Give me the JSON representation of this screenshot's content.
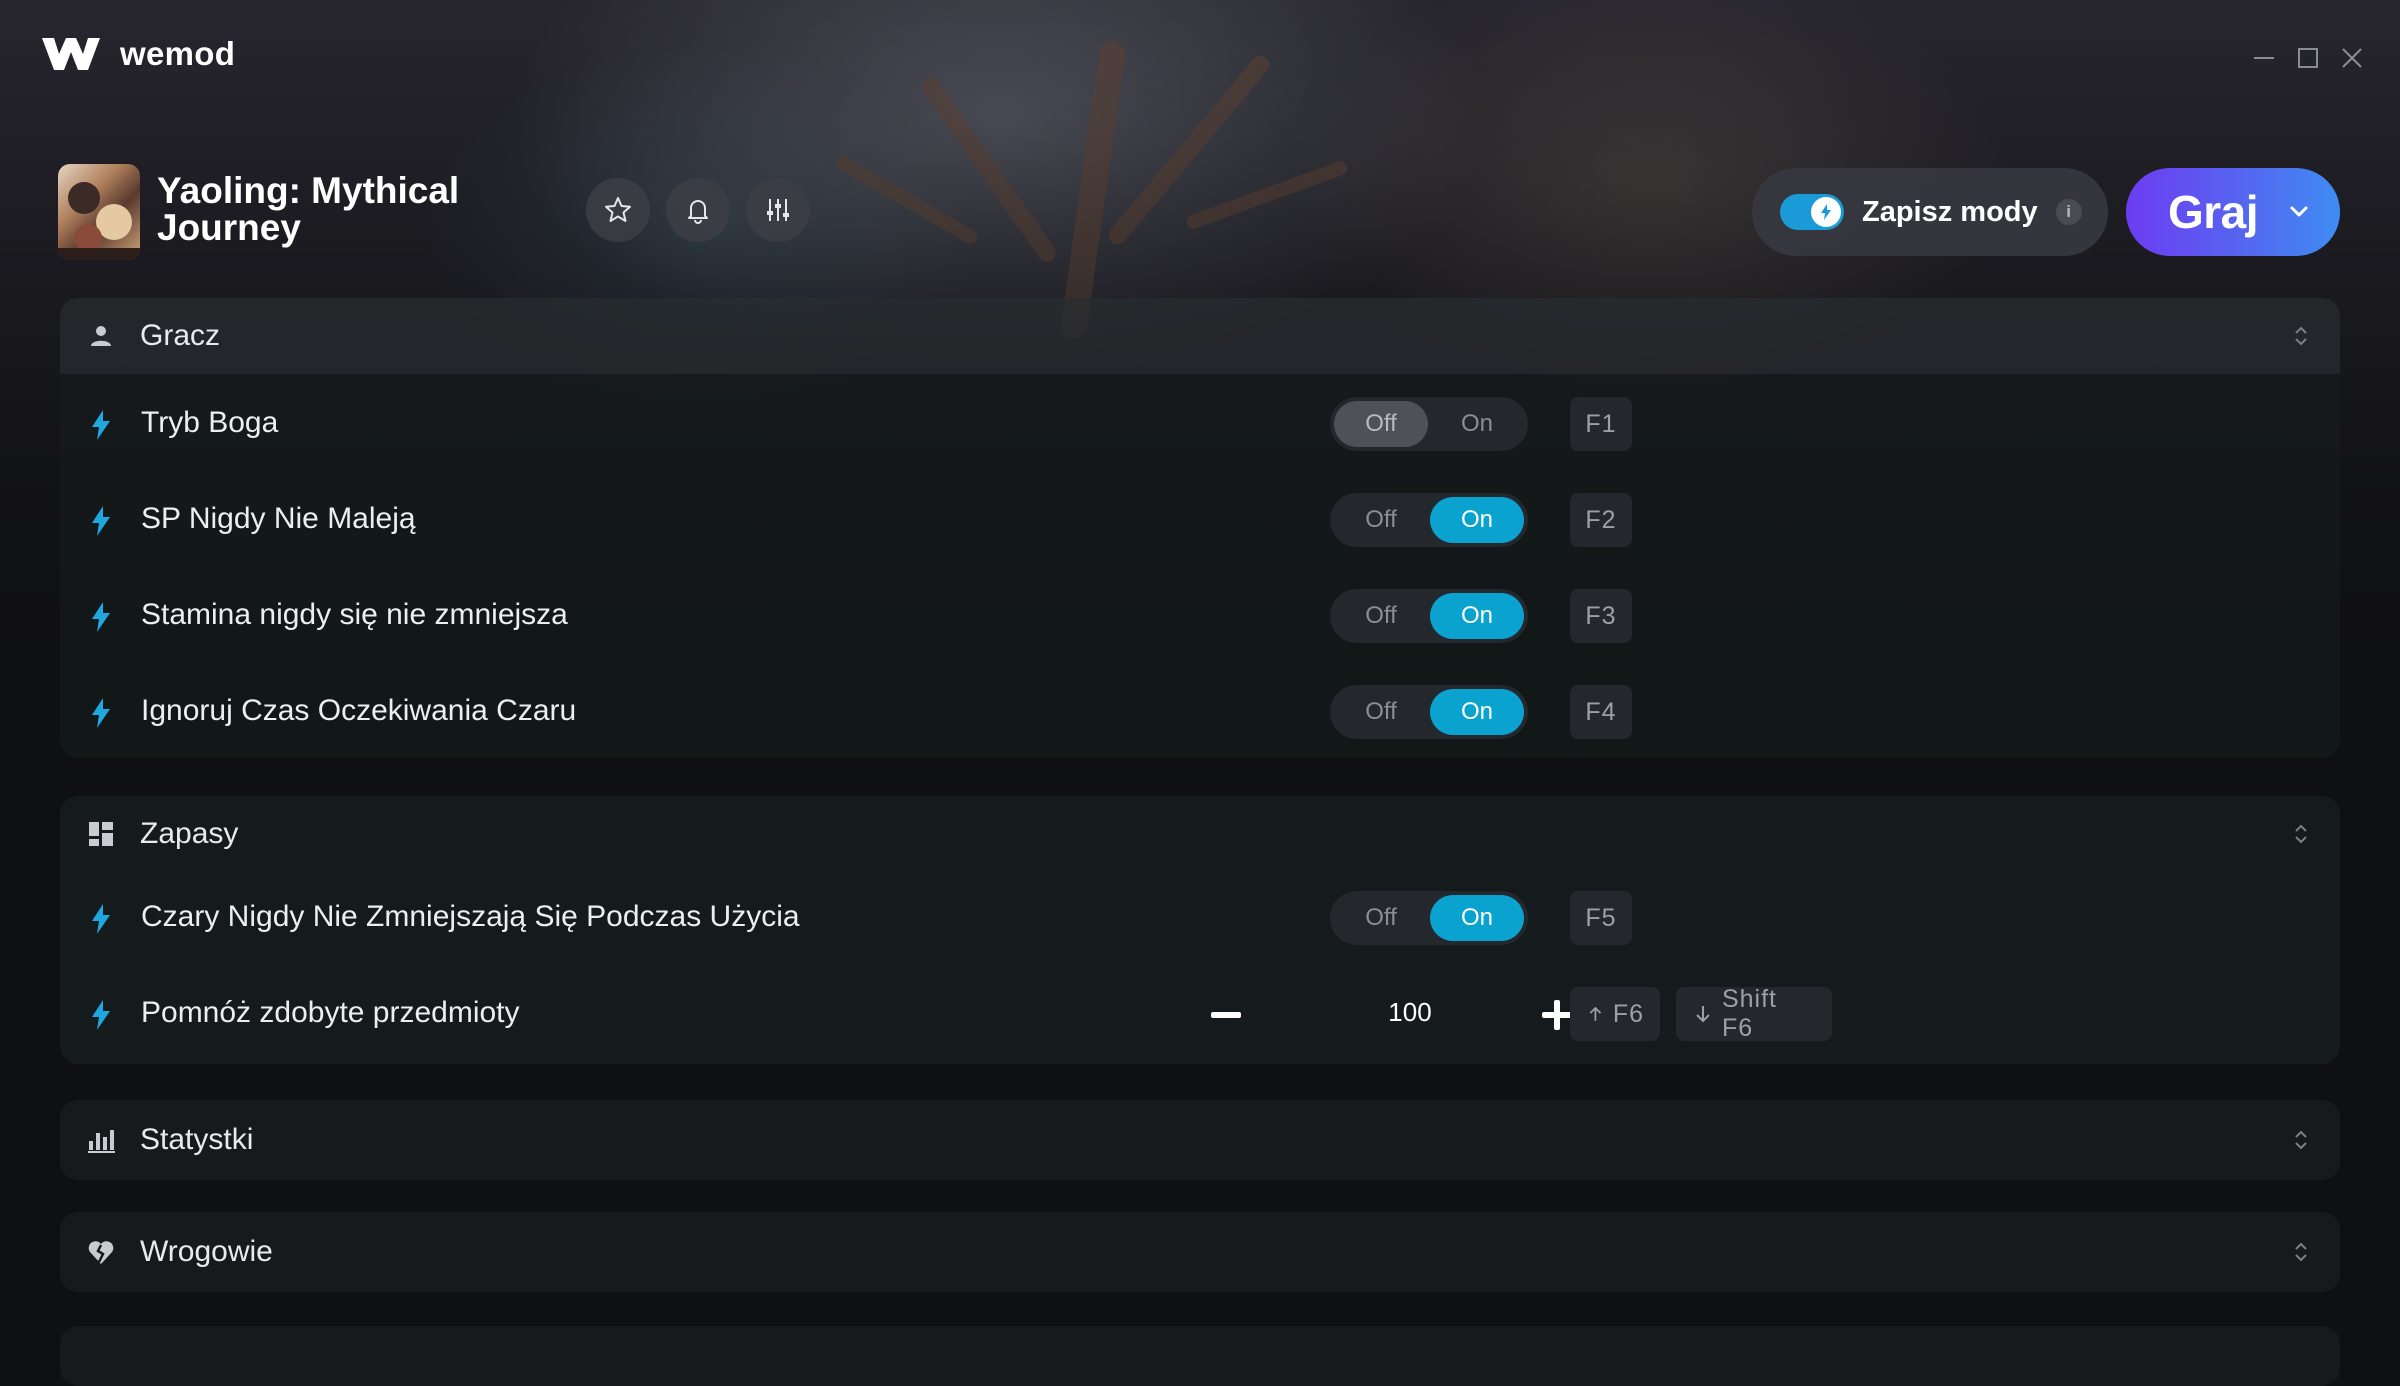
{
  "app": {
    "brand": "wemod"
  },
  "window": {
    "minimize": "minimize",
    "maximize": "maximize",
    "close": "close"
  },
  "game": {
    "title": "Yaoling: Mythical Journey"
  },
  "header": {
    "favorite_icon": "star-icon",
    "notify_icon": "bell-icon",
    "settings_icon": "sliders-icon",
    "save_mods_label": "Zapisz mody",
    "save_mods_enabled": true,
    "info_label": "i",
    "play_label": "Graj"
  },
  "sections": [
    {
      "title": "Gracz",
      "icon": "person-icon",
      "rows": [
        {
          "label": "Tryb Boga",
          "off": "Off",
          "on": "On",
          "state": "off",
          "hotkey": "F1"
        },
        {
          "label": "SP Nigdy Nie Maleją",
          "off": "Off",
          "on": "On",
          "state": "on",
          "hotkey": "F2"
        },
        {
          "label": "Stamina nigdy się nie zmniejsza",
          "off": "Off",
          "on": "On",
          "state": "on",
          "hotkey": "F3"
        },
        {
          "label": "Ignoruj Czas Oczekiwania Czaru",
          "off": "Off",
          "on": "On",
          "state": "on",
          "hotkey": "F4"
        }
      ]
    },
    {
      "title": "Zapasy",
      "icon": "dashboard-icon",
      "rows": [
        {
          "label": "Czary Nigdy Nie Zmniejszają Się Podczas Użycia",
          "off": "Off",
          "on": "On",
          "state": "on",
          "hotkey": "F5"
        },
        {
          "label": "Pomnóż zdobyte przedmioty",
          "value": "100",
          "hotkey_up": "F6",
          "hotkey_down": "Shift F6"
        }
      ]
    },
    {
      "title": "Statystki",
      "icon": "bar-chart-icon"
    },
    {
      "title": "Wrogowie",
      "icon": "broken-heart-icon"
    }
  ],
  "colors": {
    "accent": "#0aa3cf",
    "play_start": "#6d3cf2",
    "play_end": "#3f8cf3",
    "bolt": "#1ea7e0"
  }
}
